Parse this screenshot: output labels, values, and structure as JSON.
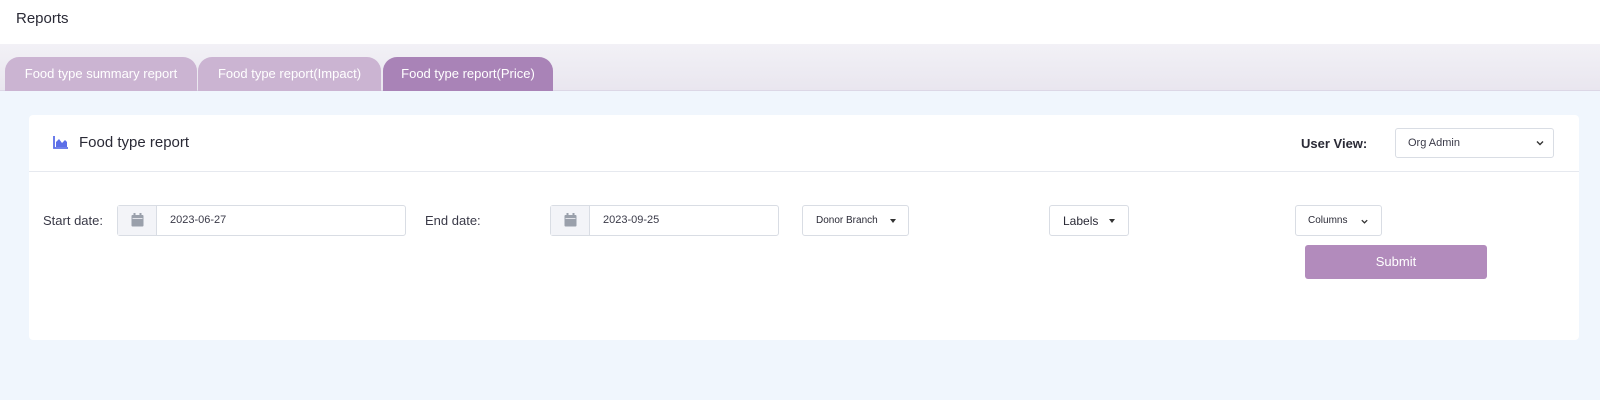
{
  "header": {
    "title": "Reports"
  },
  "tabs": [
    {
      "label": "Food type summary report",
      "active": false
    },
    {
      "label": "Food type report(Impact)",
      "active": false
    },
    {
      "label": "Food type report(Price)",
      "active": true
    }
  ],
  "card": {
    "title": "Food type report",
    "title_icon": "area-chart-icon",
    "user_view": {
      "label": "User View:",
      "selected": "Org Admin"
    }
  },
  "filters": {
    "start_date": {
      "label": "Start date:",
      "value": "2023-06-27",
      "icon": "calendar-icon"
    },
    "end_date": {
      "label": "End date:",
      "value": "2023-09-25",
      "icon": "calendar-icon"
    },
    "donor_branch": {
      "label": "Donor Branch"
    },
    "labels": {
      "label": "Labels"
    },
    "columns": {
      "label": "Columns"
    },
    "submit_label": "Submit"
  },
  "colors": {
    "tab_inactive": "#cbb4d2",
    "tab_active": "#a983b7",
    "submit": "#b28bbc",
    "page_bg": "#f0f6fd",
    "icon_accent": "#5b6ee8"
  }
}
